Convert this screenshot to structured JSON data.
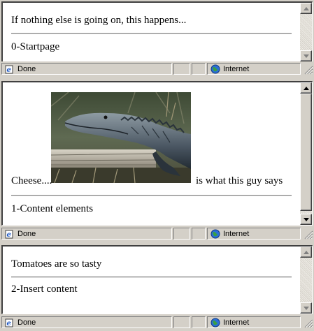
{
  "windows": [
    {
      "paragraph": "If nothing else is going on, this happens...",
      "caption": "0-Startpage",
      "status": {
        "text": "Done",
        "zone": "Internet"
      }
    },
    {
      "paragraph_before": "Cheese....",
      "paragraph_after": "is what this guy says",
      "caption": "1-Content elements",
      "status": {
        "text": "Done",
        "zone": "Internet"
      }
    },
    {
      "paragraph": "Tomatoes are so tasty",
      "caption": "2-Insert content",
      "status": {
        "text": "Done",
        "zone": "Internet"
      }
    }
  ],
  "icons": {
    "page_icon": "ie-page-icon",
    "zone_icon": "internet-globe-icon",
    "scroll_up": "arrow-up-icon",
    "scroll_down": "arrow-down-icon",
    "grip": "resize-grip-icon"
  },
  "image": {
    "subject": "alligator"
  }
}
